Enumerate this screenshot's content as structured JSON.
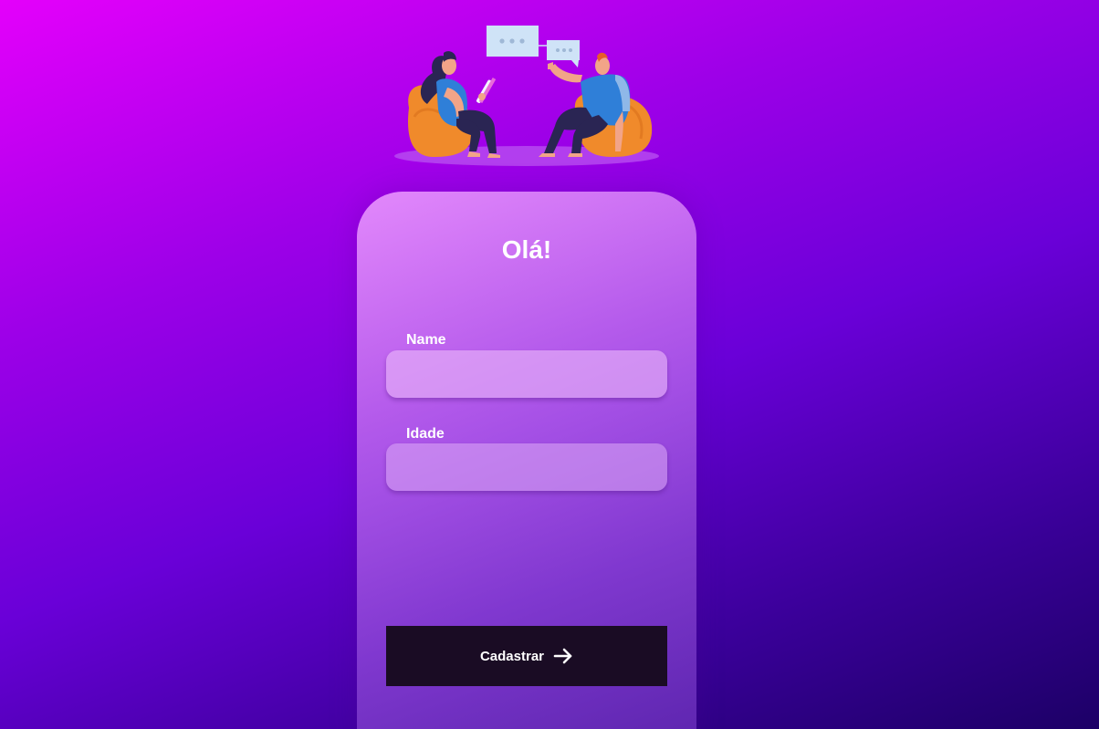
{
  "form": {
    "title": "Olá!",
    "name_label": "Name",
    "name_value": "",
    "idade_label": "Idade",
    "idade_value": "",
    "submit_label": "Cadastrar",
    "submit_icon": "arrow-right-icon"
  },
  "illustration": {
    "subject": "conversation-illustration",
    "bubble_icon": "chat-bubble-icon"
  },
  "colors": {
    "background_start": "#e400fb",
    "background_end": "#1c0066",
    "button": "#1a0c24",
    "seat": "#f08a2b",
    "shirt": "#2f7fd8"
  }
}
